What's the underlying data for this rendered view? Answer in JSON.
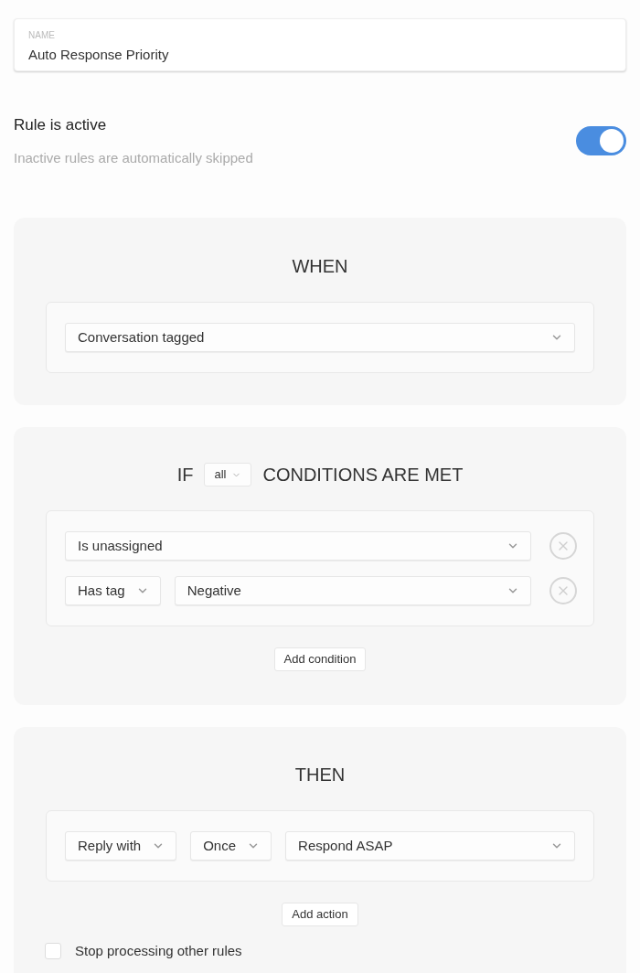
{
  "name_field": {
    "label": "NAME",
    "value": "Auto Response Priority"
  },
  "active": {
    "title": "Rule is active",
    "subtitle": "Inactive rules are automatically skipped",
    "on": true
  },
  "when": {
    "title": "WHEN",
    "trigger": "Conversation tagged"
  },
  "if": {
    "prefix": "IF",
    "match": "all",
    "suffix": "CONDITIONS ARE MET",
    "conditions": [
      {
        "selects": [
          "Is unassigned"
        ]
      },
      {
        "selects": [
          "Has tag",
          "Negative"
        ]
      }
    ],
    "add_button": "Add condition"
  },
  "then": {
    "title": "THEN",
    "actions": [
      {
        "selects": [
          "Reply with",
          "Once",
          "Respond ASAP"
        ]
      }
    ],
    "add_button": "Add action",
    "stop": {
      "label": "Stop processing other rules",
      "checked": false
    }
  }
}
